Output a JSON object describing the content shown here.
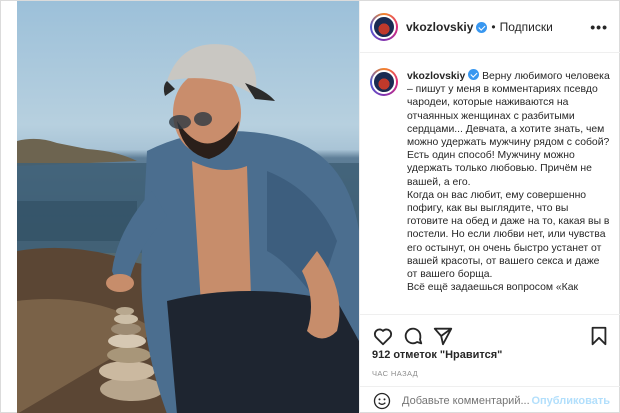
{
  "post": {
    "username": "vkozlovskiy",
    "separator": "•",
    "follow_label": "Подписки",
    "more_label": "•••"
  },
  "caption": {
    "username": "vkozlovskiy",
    "lines": [
      "Верну любимого человека – пишут у меня в комментариях псевдо чародеи, которые наживаются на отчаянных женщинах с разбитыми сердцами... Девчата, а хотите знать, чем можно удержать мужчину рядом с собой? Есть один способ! Мужчину можно удержать только любовью. Причём не вашей, а его.",
      "Когда он вас любит, ему совершенно пофигу, как вы выглядите, что вы готовите на обед и даже на то, какая вы в постели. Но если любви нет, или чувства его остынут, он очень быстро устанет от вашей красоты, от вашего секса и даже от вашего борща.",
      "Всё ещё задаешься вопросом «Как"
    ]
  },
  "actions": {
    "icons": [
      "heart-icon",
      "comment-icon",
      "share-icon",
      "bookmark-icon"
    ]
  },
  "likes_text": "912 отметок \"Нравится\"",
  "time_text": "ЧАС НАЗАД",
  "comment_box": {
    "placeholder": "Добавьте комментарий...",
    "publish_label": "Опубликовать",
    "icon": "emoji-icon"
  },
  "colors": {
    "verified": "#3897f0",
    "publish_disabled": "#b2dffc",
    "muted": "#8e8e8e"
  }
}
